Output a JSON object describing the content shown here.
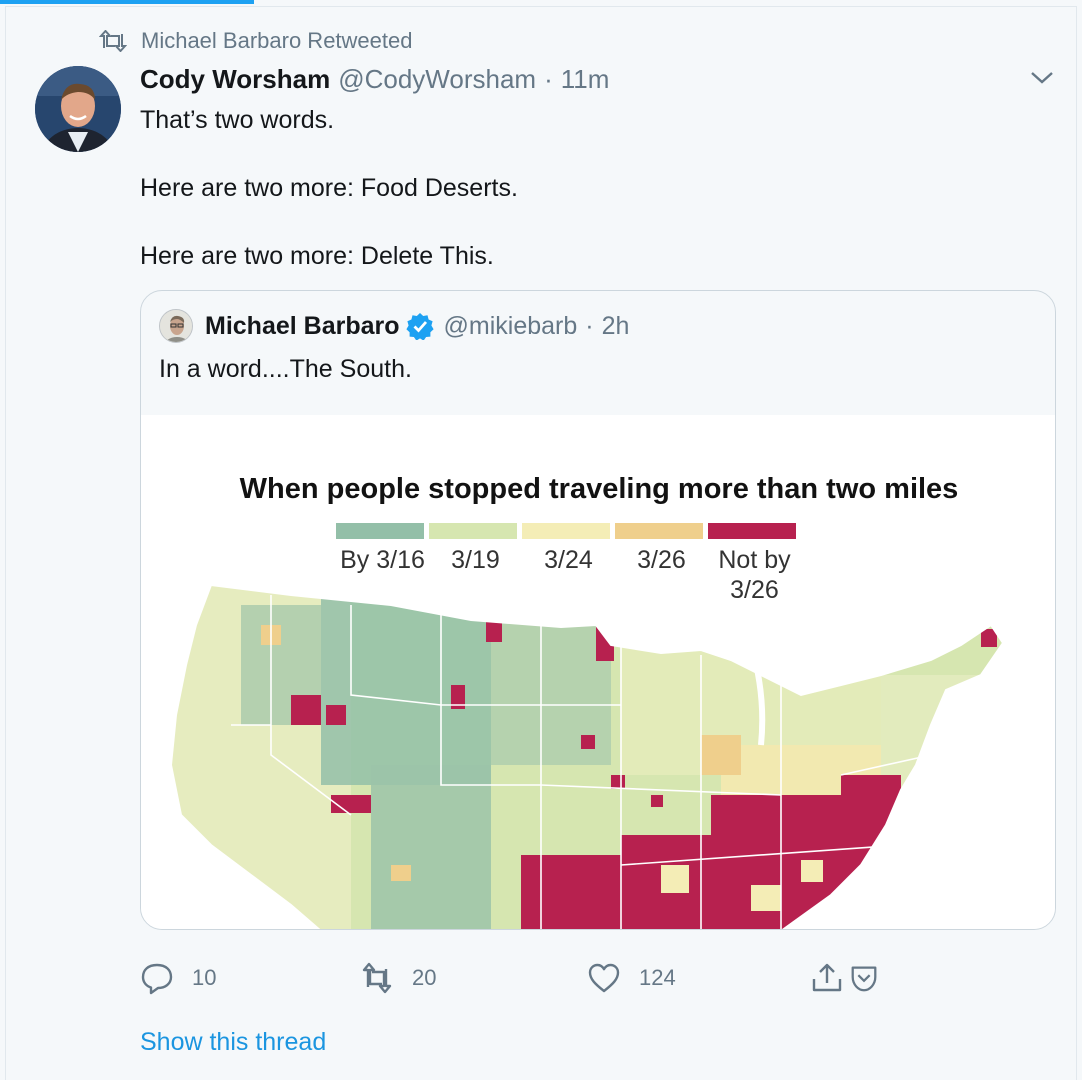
{
  "context": {
    "label": "Michael Barbaro Retweeted"
  },
  "tweet": {
    "author_name": "Cody Worsham",
    "handle": "@CodyWorsham",
    "separator": "·",
    "time": "11m",
    "lines": [
      "That’s two words.",
      "Here are two more: Food Deserts.",
      "Here are two more: Delete This."
    ]
  },
  "quote": {
    "author_name": "Michael Barbaro",
    "handle": "@mikiebarb",
    "separator": "·",
    "time": "2h",
    "text": "In a word....The South.",
    "media": {
      "title": "When people stopped traveling more than two miles",
      "legend": [
        {
          "label": "By 3/16",
          "color": "#93bfa8"
        },
        {
          "label": "3/19",
          "color": "#d6e6b0"
        },
        {
          "label": "3/24",
          "color": "#f4edb6"
        },
        {
          "label": "3/26",
          "color": "#efcf8c"
        },
        {
          "label": "Not by 3/26",
          "color": "#b7214f"
        }
      ]
    }
  },
  "actions": {
    "reply_count": "10",
    "retweet_count": "20",
    "like_count": "124"
  },
  "show_thread": "Show this thread",
  "colors": {
    "accent": "#1da1f2",
    "link": "#1b95e0",
    "muted": "#657786"
  },
  "icons": [
    "retweet-icon",
    "chevron-down-icon",
    "verified-badge-icon",
    "reply-icon",
    "retweet-icon",
    "like-icon",
    "share-icon",
    "save-icon"
  ]
}
